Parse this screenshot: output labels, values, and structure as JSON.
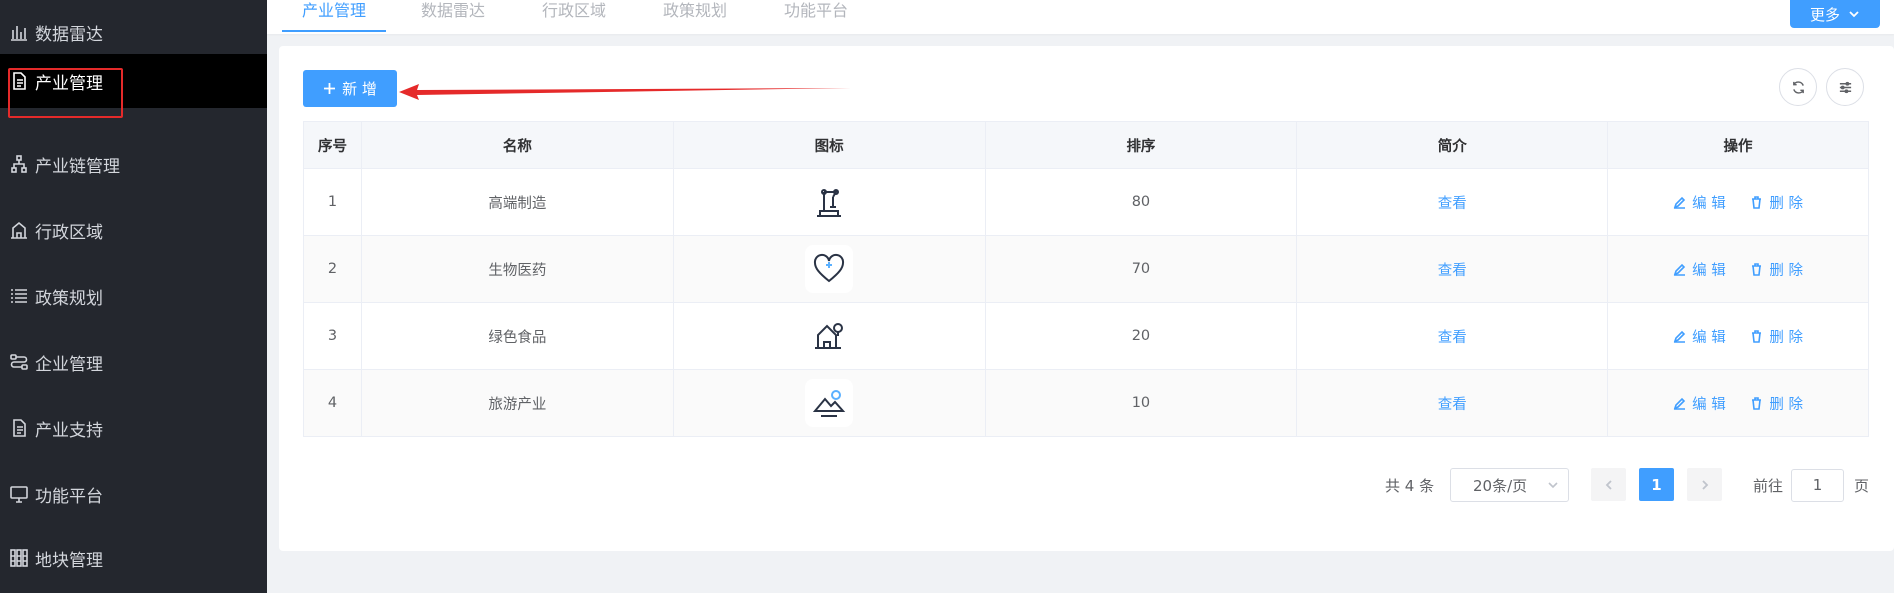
{
  "sidebar": {
    "items": [
      {
        "label": "数据雷达",
        "icon": "bar-chart-icon"
      },
      {
        "label": "产业管理",
        "icon": "document-icon",
        "active": true
      },
      {
        "label": "产业链管理",
        "icon": "hierarchy-icon"
      },
      {
        "label": "行政区域",
        "icon": "building-icon"
      },
      {
        "label": "政策规划",
        "icon": "list-icon"
      },
      {
        "label": "企业管理",
        "icon": "route-icon"
      },
      {
        "label": "产业支持",
        "icon": "document-icon"
      },
      {
        "label": "功能平台",
        "icon": "monitor-icon"
      },
      {
        "label": "地块管理",
        "icon": "blocks-icon"
      }
    ]
  },
  "tabs": [
    {
      "label": "产业管理",
      "active": true
    },
    {
      "label": "数据雷达"
    },
    {
      "label": "行政区域"
    },
    {
      "label": "政策规划"
    },
    {
      "label": "功能平台"
    }
  ],
  "more_label": "更多",
  "toolbar": {
    "add_label": "新 增"
  },
  "table": {
    "headers": [
      "序号",
      "名称",
      "图标",
      "排序",
      "简介",
      "操作"
    ],
    "rows": [
      {
        "index": "1",
        "name": "高端制造",
        "icon": "robot-arm-icon",
        "sort": "80",
        "intro": "查看"
      },
      {
        "index": "2",
        "name": "生物医药",
        "icon": "heart-medical-icon",
        "sort": "70",
        "intro": "查看"
      },
      {
        "index": "3",
        "name": "绿色食品",
        "icon": "green-house-icon",
        "sort": "20",
        "intro": "查看"
      },
      {
        "index": "4",
        "name": "旅游产业",
        "icon": "mountain-sun-icon",
        "sort": "10",
        "intro": "查看"
      }
    ],
    "edit_label": "编 辑",
    "delete_label": "删 除"
  },
  "pagination": {
    "total": "共 4 条",
    "page_size": "20条/页",
    "current": "1",
    "goto_prefix": "前往",
    "goto_value": "1",
    "goto_suffix": "页"
  },
  "colors": {
    "accent": "#409eff",
    "sidebar_bg": "#24272e",
    "annotation": "#e52a2a"
  }
}
